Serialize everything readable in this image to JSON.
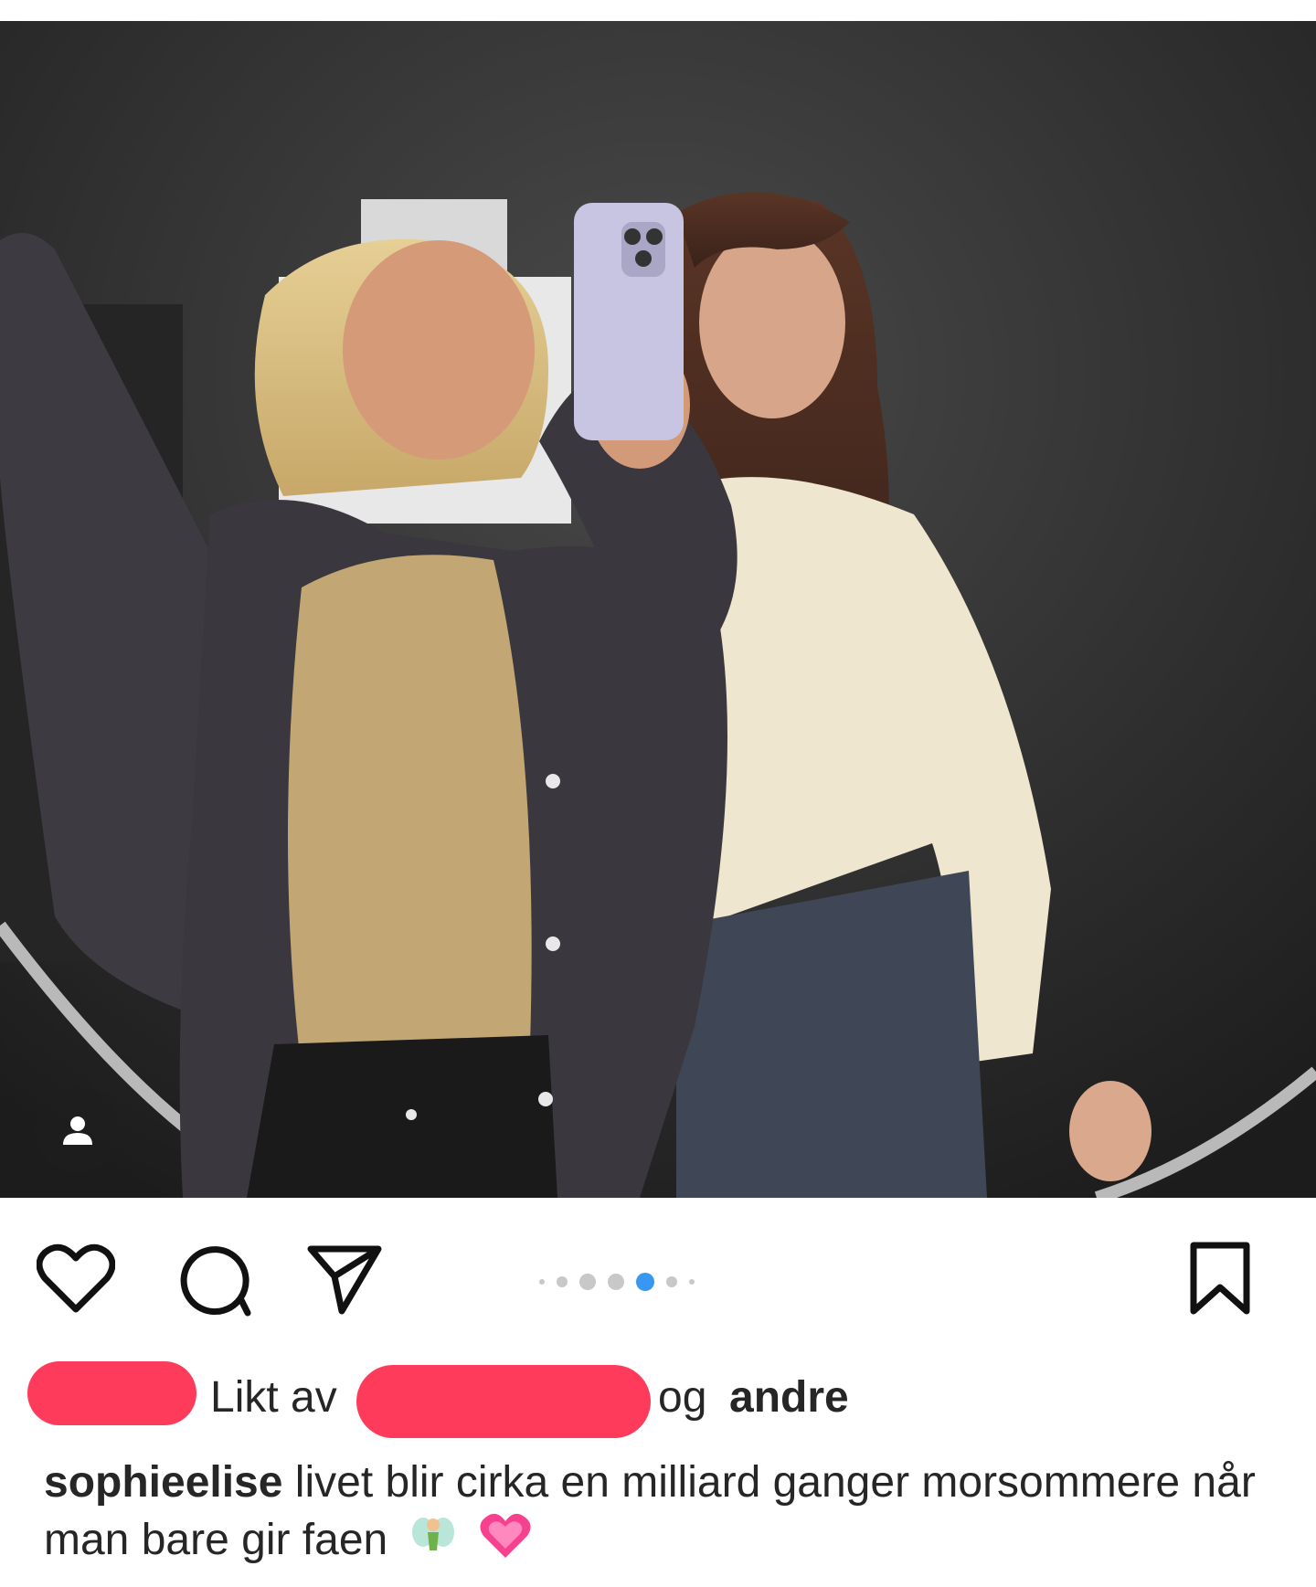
{
  "post": {
    "carousel": {
      "total": 7,
      "active_index": 4
    }
  },
  "likes": {
    "prefix": "Likt av",
    "connector": "og",
    "others": "andre"
  },
  "caption": {
    "username": "sophieelise",
    "text": "livet blir cirka en milliard ganger morsommere når man bare gir faen",
    "emojis": [
      "fairy-emoji",
      "growing-heart-emoji"
    ]
  },
  "icons": {
    "like": "heart-icon",
    "comment": "comment-icon",
    "share": "send-icon",
    "save": "bookmark-icon",
    "tag": "person-tag-icon"
  },
  "colors": {
    "accent": "#3897f0",
    "redaction": "#ff3b5c",
    "text": "#262626"
  }
}
